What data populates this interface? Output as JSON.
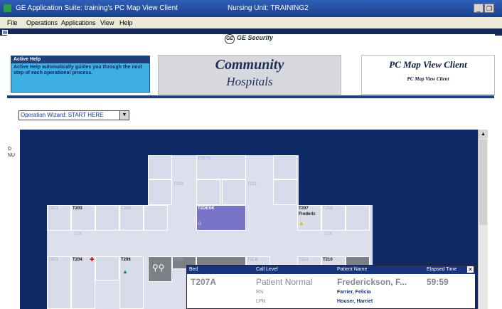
{
  "window": {
    "title": "GE Application Suite:  training's PC Map View Client",
    "unit": "Nursing Unit:  TRAINING2",
    "min": "_",
    "restore": "❐"
  },
  "menu": [
    "File",
    "Operations",
    "Applications",
    "View",
    "Help"
  ],
  "header": {
    "logo_text": "GE Security",
    "active_help_title": "Active Help",
    "active_help_text": "Active Help automatically guides you through the next step of each operational process.",
    "hospital_line1": "Community",
    "hospital_line2": "Hospitals",
    "client_title": "PC Map View Client",
    "client_subtitle": "PC Map View Client"
  },
  "wizard": {
    "label": "Operation Wizard: START HERE",
    "arrow": "▼"
  },
  "left_labels": [
    "D",
    "NU"
  ],
  "map": {
    "rooms": {
      "t207n": "T207N",
      "t209": "T209",
      "t211": "T211",
      "t203": "T203",
      "t205": "T205",
      "t2desk": "T2DESK",
      "t207": "T207",
      "t207_name": "Frederic",
      "t208": "T208",
      "t2x1": "T2X",
      "t2x2": "T2X",
      "t201": "T201",
      "t204": "T204",
      "t206": "T206",
      "t205b": "T205",
      "t2lb": "T2LB",
      "t210": "T210",
      "t212": "T212"
    }
  },
  "panel": {
    "headers": {
      "bed": "Bed",
      "call_level": "Call Level",
      "patient_name": "Patient Name",
      "elapsed": "Elapsed Time"
    },
    "close": "✕",
    "bed": "T207A",
    "level": "Patient Normal",
    "patient": "Frederickson, F...",
    "elapsed": "59:59",
    "staff": [
      {
        "role": "RN",
        "name": "Farrier, Felicia"
      },
      {
        "role": "LPN",
        "name": "Houser, Harriet"
      }
    ]
  },
  "scroll": {
    "up": "▲"
  }
}
